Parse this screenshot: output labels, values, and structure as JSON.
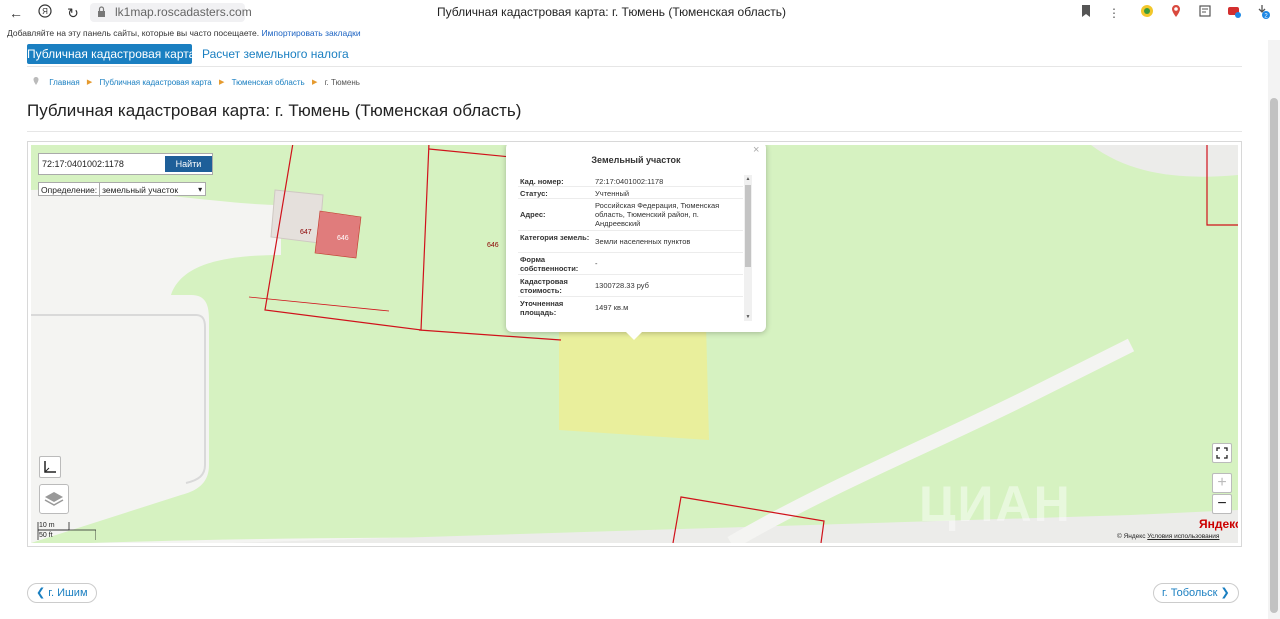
{
  "browser": {
    "url": "lk1map.roscadasters.com",
    "tab_title": "Публичная кадастровая карта: г. Тюмень (Тюменская область)",
    "bookmarks_text": "Добавляйте на эту панель сайты, которые вы часто посещаете.",
    "bookmarks_link": "Импортировать закладки",
    "badge_count": "2"
  },
  "site_tabs": {
    "active": "Публичная кадастровая карта",
    "link": "Расчет земельного налога"
  },
  "breadcrumb": {
    "items": [
      "Главная",
      "Публичная кадастровая карта",
      "Тюменская область"
    ],
    "current": "г. Тюмень"
  },
  "page_title": "Публичная кадастровая карта: г. Тюмень (Тюменская область)",
  "map": {
    "search_value": "72:17:0401002:1178",
    "search_button": "Найти",
    "definition_label": "Определение:",
    "definition_value": "земельный участок",
    "parcel_labels": [
      "647",
      "646",
      "646"
    ],
    "scale_m": "10 m",
    "scale_ft": "50 ft",
    "yandex_logo": "Яндекс",
    "yandex_copy": "© Яндекс",
    "terms_link": "Условия использования",
    "watermark": "ЦИАН",
    "colors": {
      "grass": "#d6f2c1",
      "selected_parcel": "#e9ef9c",
      "parcel_border": "#d0121b",
      "building": "#e5e0dc",
      "building_highlight": "#e07c7c"
    }
  },
  "popup": {
    "title": "Земельный участок",
    "rows": [
      {
        "key": "Кад. номер:",
        "value": "72:17:0401002:1178"
      },
      {
        "key": "Статус:",
        "value": "Учтенный"
      },
      {
        "key": "Адрес:",
        "value": "Российская Федерация, Тюменская область, Тюменский район, п. Андреевский"
      },
      {
        "key": "Категория земель:",
        "value": "Земли населенных пунктов"
      },
      {
        "key": "Форма собственности:",
        "value": "-"
      },
      {
        "key": "Кадастровая стоимость:",
        "value": "1300728.33 руб"
      },
      {
        "key": "Уточненная площадь:",
        "value": "1497 кв.м"
      }
    ]
  },
  "pager": {
    "prev": "г. Ишим",
    "next": "г. Тобольск"
  }
}
